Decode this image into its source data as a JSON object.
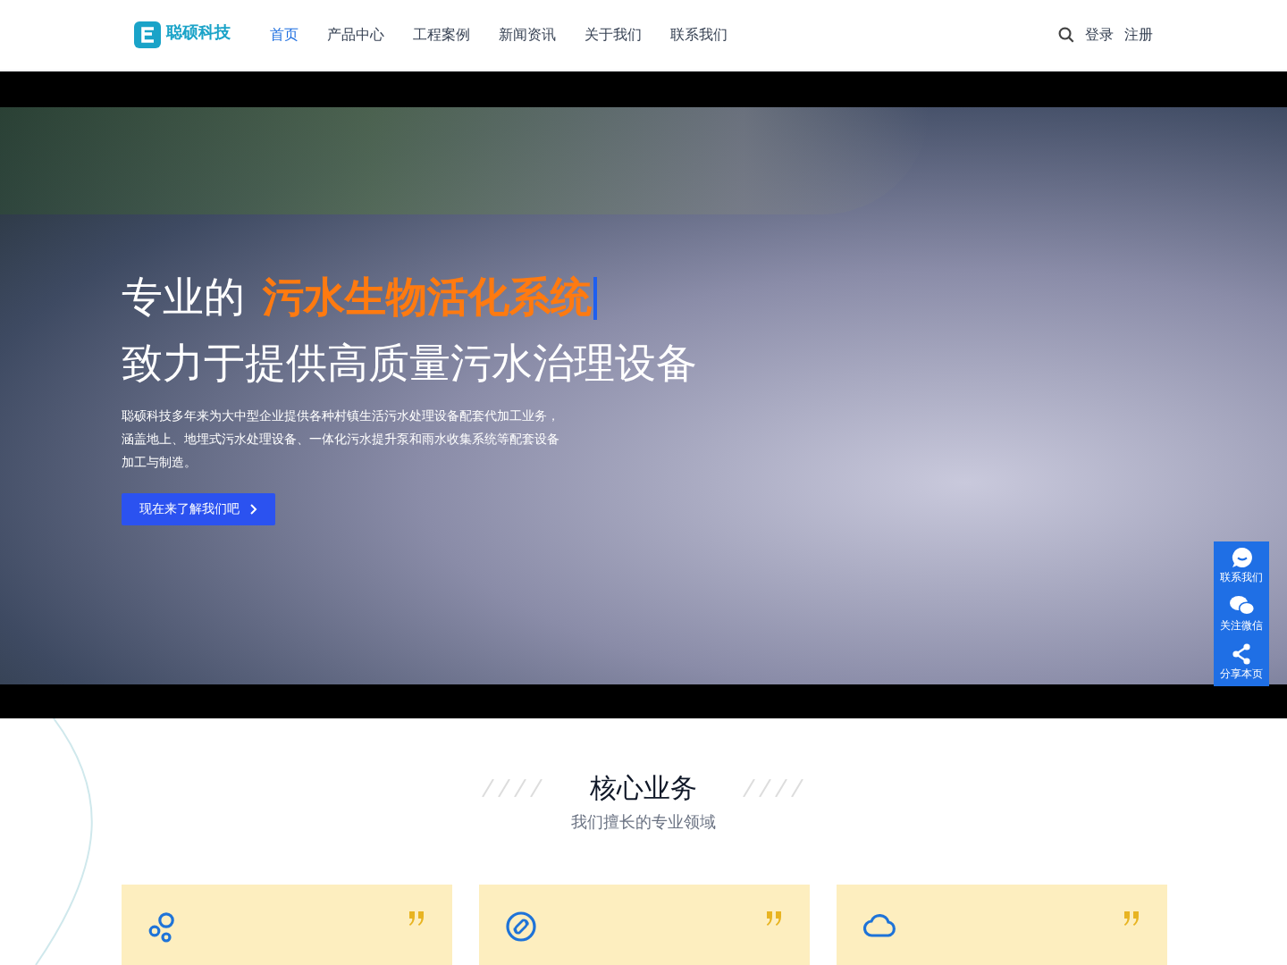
{
  "header": {
    "logo_text": "聪硕科技",
    "nav": [
      {
        "label": "首页",
        "selected": true
      },
      {
        "label": "产品中心",
        "selected": false
      },
      {
        "label": "工程案例",
        "selected": false
      },
      {
        "label": "新闻资讯",
        "selected": false
      },
      {
        "label": "关于我们",
        "selected": false
      },
      {
        "label": "联系我们",
        "selected": false
      }
    ],
    "login": "登录",
    "register": "注册"
  },
  "hero": {
    "title_prefix": "专业的",
    "title_highlight": "污水生物活化系统",
    "subtitle": "致力于提供高质量污水治理设备",
    "description": "聪硕科技多年来为大中型企业提供各种村镇生活污水处理设备配套代加工业务，涵盖地上、地埋式污水处理设备、一体化污水提升泵和雨水收集系统等配套设备加工与制造。",
    "button": "现在来了解我们吧"
  },
  "side_panel": [
    {
      "kind": "chat",
      "label": "联系我们"
    },
    {
      "kind": "wechat",
      "label": "关注微信"
    },
    {
      "kind": "share",
      "label": "分享本页"
    }
  ],
  "section": {
    "title": "核心业务",
    "subtitle": "我们擅长的专业领域"
  },
  "cards": [
    {
      "kind": "bubbles"
    },
    {
      "kind": "link"
    },
    {
      "kind": "cloud"
    }
  ]
}
